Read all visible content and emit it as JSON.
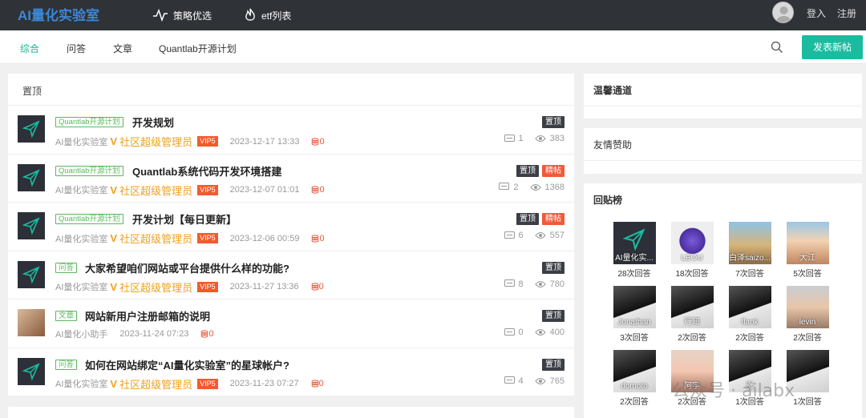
{
  "header": {
    "logo": "AI量化实验室",
    "nav": [
      {
        "label": "策略优选"
      },
      {
        "label": "etf列表"
      }
    ],
    "login": "登入",
    "register": "注册"
  },
  "subnav": {
    "tabs": [
      "综合",
      "问答",
      "文章",
      "Quantlab开源计划"
    ],
    "active": "综合",
    "post_button": "发表新帖"
  },
  "main": {
    "section_title": "置顶",
    "posts": [
      {
        "tag": "Quantlab开源计划",
        "title": "开发规划",
        "author": "AI量化实验室",
        "role": "社区超级管理员",
        "vip": "VIP5",
        "date": "2023-12-17 13:33",
        "coins": "0",
        "badges": [
          "置顶"
        ],
        "replies": "1",
        "views": "383"
      },
      {
        "tag": "Quantlab开源计划",
        "title": "Quantlab系统代码开发环境搭建",
        "author": "AI量化实验室",
        "role": "社区超级管理员",
        "vip": "VIP5",
        "date": "2023-12-07 01:01",
        "coins": "0",
        "badges": [
          "置顶",
          "精帖"
        ],
        "replies": "2",
        "views": "1368"
      },
      {
        "tag": "Quantlab开源计划",
        "title": "开发计划【每日更新】",
        "author": "AI量化实验室",
        "role": "社区超级管理员",
        "vip": "VIP5",
        "date": "2023-12-06 00:59",
        "coins": "0",
        "badges": [
          "置顶",
          "精帖"
        ],
        "replies": "6",
        "views": "557"
      },
      {
        "tag": "问答",
        "title": "大家希望咱们网站或平台提供什么样的功能?",
        "author": "AI量化实验室",
        "role": "社区超级管理员",
        "vip": "VIP5",
        "date": "2023-11-27 13:36",
        "coins": "0",
        "badges": [
          "置顶"
        ],
        "replies": "8",
        "views": "780"
      },
      {
        "tag": "文章",
        "title": "网站新用户注册邮箱的说明",
        "author": "AI量化小助手",
        "role": "",
        "vip": "",
        "date": "2023-11-24 07:23",
        "coins": "0",
        "badges": [
          "置顶"
        ],
        "replies": "0",
        "views": "400"
      },
      {
        "tag": "问答",
        "title": "如何在网站绑定“AI量化实验室”的星球帐户?",
        "author": "AI量化实验室",
        "role": "社区超级管理员",
        "vip": "VIP5",
        "date": "2023-11-23 07:27",
        "coins": "0",
        "badges": [
          "置顶"
        ],
        "replies": "4",
        "views": "765"
      }
    ]
  },
  "sidebar": {
    "welcome": "温馨通道",
    "sponsor": "友情赞助",
    "leaderboard_title": "回贴榜",
    "leaders": [
      {
        "name": "AI量化实...",
        "count": "28次回答"
      },
      {
        "name": "LEOU",
        "count": "18次回答"
      },
      {
        "name": "白泽saizo...",
        "count": "7次回答"
      },
      {
        "name": "大江",
        "count": "5次回答"
      },
      {
        "name": "Jonathan",
        "count": "3次回答"
      },
      {
        "name": "行知",
        "count": "2次回答"
      },
      {
        "name": "flank",
        "count": "2次回答"
      },
      {
        "name": "levin",
        "count": "2次回答"
      },
      {
        "name": "domoto",
        "count": "2次回答"
      },
      {
        "name": "阿宇",
        "count": "2次回答"
      },
      {
        "name": "涨",
        "count": "1次回答"
      },
      {
        "name": "",
        "count": "1次回答"
      }
    ]
  },
  "watermark": "公众号 · ailabx"
}
